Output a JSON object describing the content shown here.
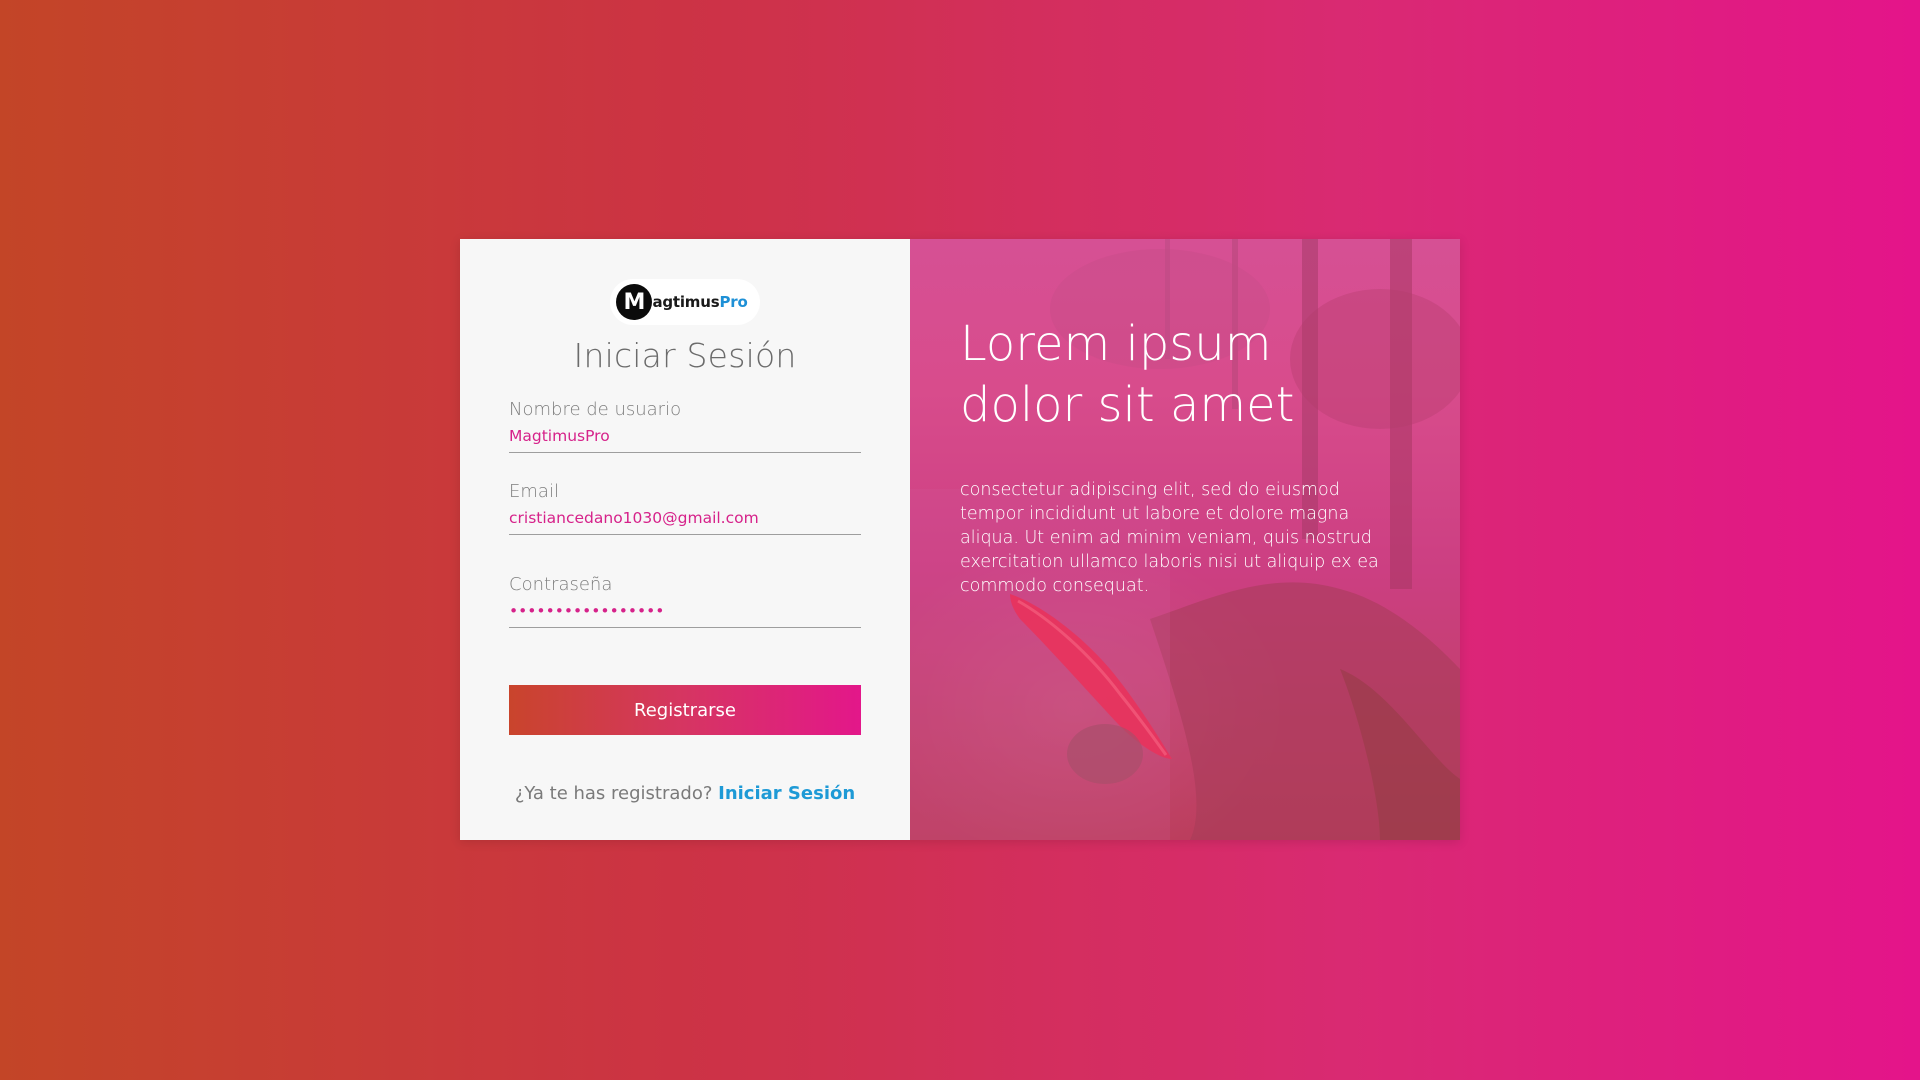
{
  "brand": {
    "mark": "M",
    "name_part": "agtimus",
    "name_accent": "Pro"
  },
  "form": {
    "title": "Iniciar Sesión",
    "fields": [
      {
        "label": "Nombre de usuario",
        "value": "MagtimusPro",
        "type": "text"
      },
      {
        "label": "Email",
        "value": "cristiancedano1030@gmail.com",
        "type": "email"
      },
      {
        "label": "Contraseña",
        "value": "cristiancedanoPro",
        "type": "password"
      }
    ],
    "submit_label": "Registrarse",
    "footer_prompt": "¿Ya te has registrado?",
    "footer_link": "Iniciar Sesión"
  },
  "hero": {
    "title": "Lorem ipsum dolor sit amet",
    "text": "consectetur adipiscing elit, sed do eiusmod tempor incididunt ut labore et dolore magna aliqua. Ut enim ad minim veniam, quis nostrud exercitation ullamco laboris nisi ut aliquip ex ea commodo consequat."
  },
  "colors": {
    "accent_text": "#d6228a",
    "link": "#1e9ad6",
    "button_gradient_start": "#c9442c",
    "button_gradient_end": "#e3178a"
  }
}
